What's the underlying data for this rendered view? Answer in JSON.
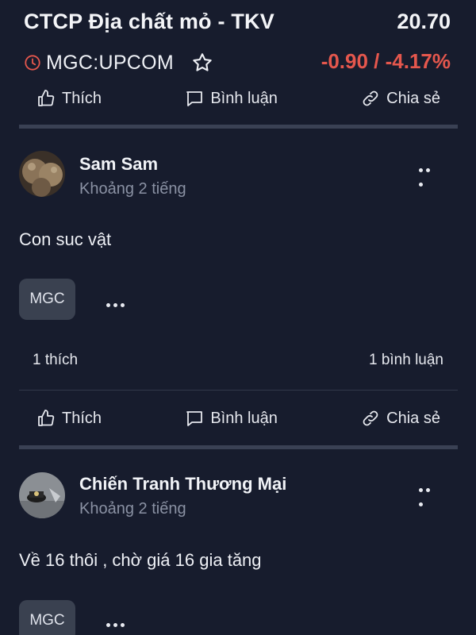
{
  "header": {
    "company_name": "CTCP Địa chất mỏ - TKV",
    "price": "20.70",
    "ticker": "MGC:UPCOM",
    "change": "-0.90 / -4.17%",
    "change_color": "#e5574d",
    "icons": [
      "clock-icon",
      "star-icon"
    ]
  },
  "actions": {
    "like": "Thích",
    "comment": "Bình luận",
    "share": "Chia sẻ",
    "icons": [
      "thumbs-up-icon",
      "comment-icon",
      "link-icon"
    ]
  },
  "posts": [
    {
      "author": "Sam Sam",
      "time": "Khoảng 2 tiếng",
      "content": "Con suc vật",
      "tag": "MGC",
      "likes": "1 thích",
      "comments": "1 bình luận"
    },
    {
      "author": "Chiến Tranh Thương Mại",
      "time": "Khoảng 2 tiếng",
      "content": "Về 16 thôi , chờ giá 16 gia tăng",
      "tag": "MGC"
    }
  ]
}
